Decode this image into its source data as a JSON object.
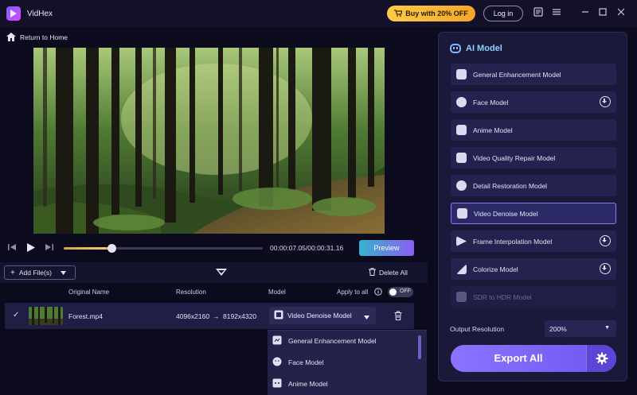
{
  "titlebar": {
    "app_name": "VidHex",
    "buy_label": "Buy with 20% OFF",
    "login_label": "Log in"
  },
  "nav": {
    "return_label": "Return to Home"
  },
  "player": {
    "timecode": "00:00:07.05/00:00:31.16",
    "progress": 0.24,
    "preview_label": "Preview"
  },
  "toolbar": {
    "add_files_label": "Add File(s)",
    "delete_all_label": "Delete All"
  },
  "table": {
    "headers": {
      "original_name": "Original Name",
      "resolution": "Resolution",
      "model": "Model",
      "apply_to_all": "Apply to all"
    },
    "toggle_label": "OFF",
    "row": {
      "name": "Forest.mp4",
      "res_from": "4096x2160",
      "arrow": "→",
      "res_to": "8192x4320",
      "model": "Video Denoise Model"
    }
  },
  "dropdown": {
    "items": [
      "General Enhancement Model",
      "Face Model",
      "Anime Model"
    ]
  },
  "panel": {
    "title": "AI Model",
    "models": [
      "General Enhancement Model",
      "Face Model",
      "Anime Model",
      "Video Quality Repair Model",
      "Detail Restoration Model",
      "Video Denoise Model",
      "Frame Interpolation Model",
      "Colorize Model",
      "SDR to HDR Model"
    ],
    "selected_model": "Video Denoise Model",
    "output_resolution_label": "Output Resolution",
    "output_resolution_value": "200%",
    "export_label": "Export All"
  },
  "colors": {
    "accent": "#7d66f5",
    "buy": "#f6b83a",
    "background": "#0c0b1e",
    "panel": "#1a193a"
  }
}
